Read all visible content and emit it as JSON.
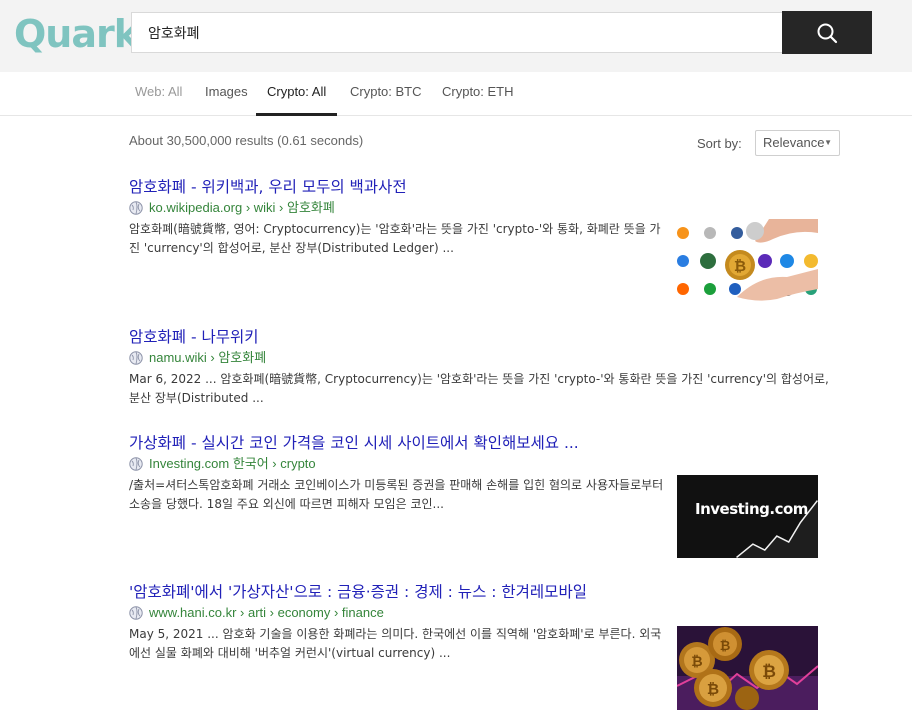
{
  "header": {
    "logo": "Quark",
    "search_value": "암호화폐",
    "search_icon": "search-icon"
  },
  "tabs": [
    {
      "label": "Web: All"
    },
    {
      "label": "Images"
    },
    {
      "label": "Crypto: All"
    },
    {
      "label": "Crypto: BTC"
    },
    {
      "label": "Crypto: ETH"
    }
  ],
  "active_tab": "Crypto: All",
  "stats": "About 30,500,000 results (0.61 seconds)",
  "sort": {
    "label": "Sort by:",
    "value": "Relevance"
  },
  "results": [
    {
      "title": "암호화폐 - 위키백과, 우리 모두의 백과사전",
      "url": "ko.wikipedia.org › wiki › 암호화폐",
      "snippet": "암호화폐(暗號貨幣, 영어: Cryptocurrency)는 '암호화'라는 뜻을 가진 'crypto-'와 통화, 화폐란 뜻을 가진 'currency'의 합성어로, 분산 장부(Distributed Ledger) ..."
    },
    {
      "title": "암호화폐 - 나무위키",
      "url": "namu.wiki › 암호화폐",
      "snippet": "Mar 6, 2022 ... 암호화폐(暗號貨幣, Cryptocurrency)는 '암호화'라는 뜻을 가진 'crypto-'와 통화란 뜻을 가진 'currency'의 합성어로, 분산 장부(Distributed ..."
    },
    {
      "title": "가상화폐 - 실시간 코인 가격을 코인 시세 사이트에서 확인해보세요 ...",
      "url": "Investing.com 한국어 › crypto",
      "snippet": "/출처=셔터스톡암호화폐 거래소 코인베이스가 미등록된 증권을 판매해 손해를 입힌 혐의로 사용자들로부터 소송을 당했다. 18일 주요 외신에 따르면 피해자 모임은 코인...",
      "thumb_text": "Investing.com"
    },
    {
      "title": "'암호화폐'에서 '가상자산'으로 : 금융·증권 : 경제 : 뉴스 : 한겨레모바일",
      "url": "www.hani.co.kr › arti › economy › finance",
      "snippet": "May 5, 2021 ... 암호화 기술을 이용한 화폐라는 의미다. 한국에선 이를 직역해 '암호화폐'로 부른다. 외국에선 실물 화폐와 대비해 '버추얼 커런시'(virtual currency) ..."
    }
  ],
  "colors": {
    "logo": "#7fc4c0",
    "link": "#2121b8",
    "url": "#35853b",
    "search_button": "#262626"
  }
}
